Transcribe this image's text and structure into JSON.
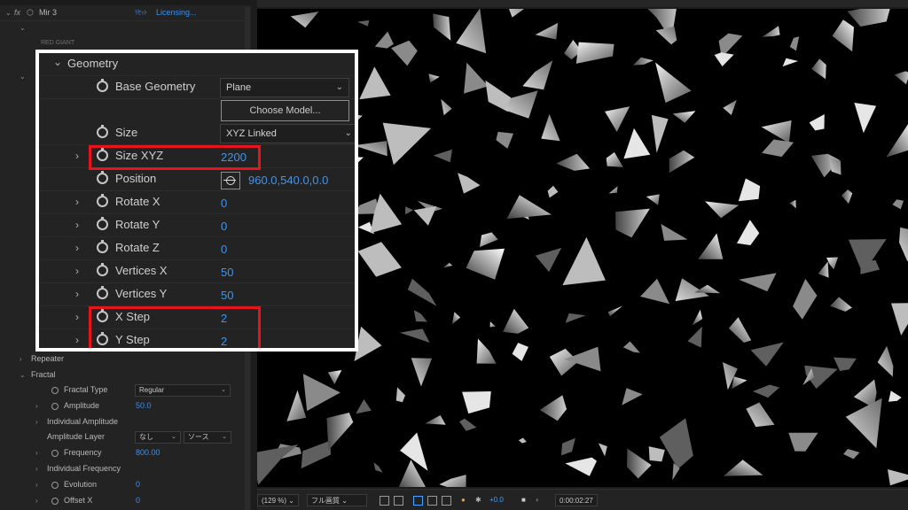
{
  "panel": {
    "effect_name": "Mir 3",
    "reset_label": "ﾘｾｯﾄ",
    "licensing_label": "Licensing...",
    "brand_label": "RED GIANT",
    "section_repeater": "Repeater",
    "section_fractal": "Fractal",
    "rows": [
      {
        "label": "Fractal Type",
        "dropdown": "Regular"
      },
      {
        "label": "Amplitude",
        "value": "50.0"
      },
      {
        "label": "Individual Amplitude"
      },
      {
        "label": "Amplitude Layer",
        "dropdown": "なし",
        "dropdown2": "ソース"
      },
      {
        "label": "Frequency",
        "value": "800.00"
      },
      {
        "label": "Individual Frequency"
      },
      {
        "label": "Evolution",
        "value": "0"
      },
      {
        "label": "Offset X",
        "value": "0"
      }
    ]
  },
  "inset": {
    "section_title": "Geometry",
    "base_geometry": {
      "label": "Base Geometry",
      "value": "Plane"
    },
    "choose_model_label": "Choose Model...",
    "size": {
      "label": "Size",
      "value": "XYZ Linked"
    },
    "size_xyz": {
      "label": "Size XYZ",
      "value": "2200"
    },
    "position": {
      "label": "Position",
      "value": "960.0,540.0,0.0"
    },
    "rotate_x": {
      "label": "Rotate X",
      "value": "0"
    },
    "rotate_y": {
      "label": "Rotate Y",
      "value": "0"
    },
    "rotate_z": {
      "label": "Rotate Z",
      "value": "0"
    },
    "vertices_x": {
      "label": "Vertices X",
      "value": "50"
    },
    "vertices_y": {
      "label": "Vertices Y",
      "value": "50"
    },
    "x_step": {
      "label": "X Step",
      "value": "2"
    },
    "y_step": {
      "label": "Y Step",
      "value": "2"
    },
    "highlight_color": "#e8141d"
  },
  "viewer": {
    "zoom": "(129 %)",
    "resolution": "フル画質",
    "exposure": "+0.0",
    "timecode": "0:00:02:27"
  },
  "colors": {
    "value_blue": "#3c8fe8",
    "panel_bg": "#232323",
    "render_bg": "#000000"
  }
}
